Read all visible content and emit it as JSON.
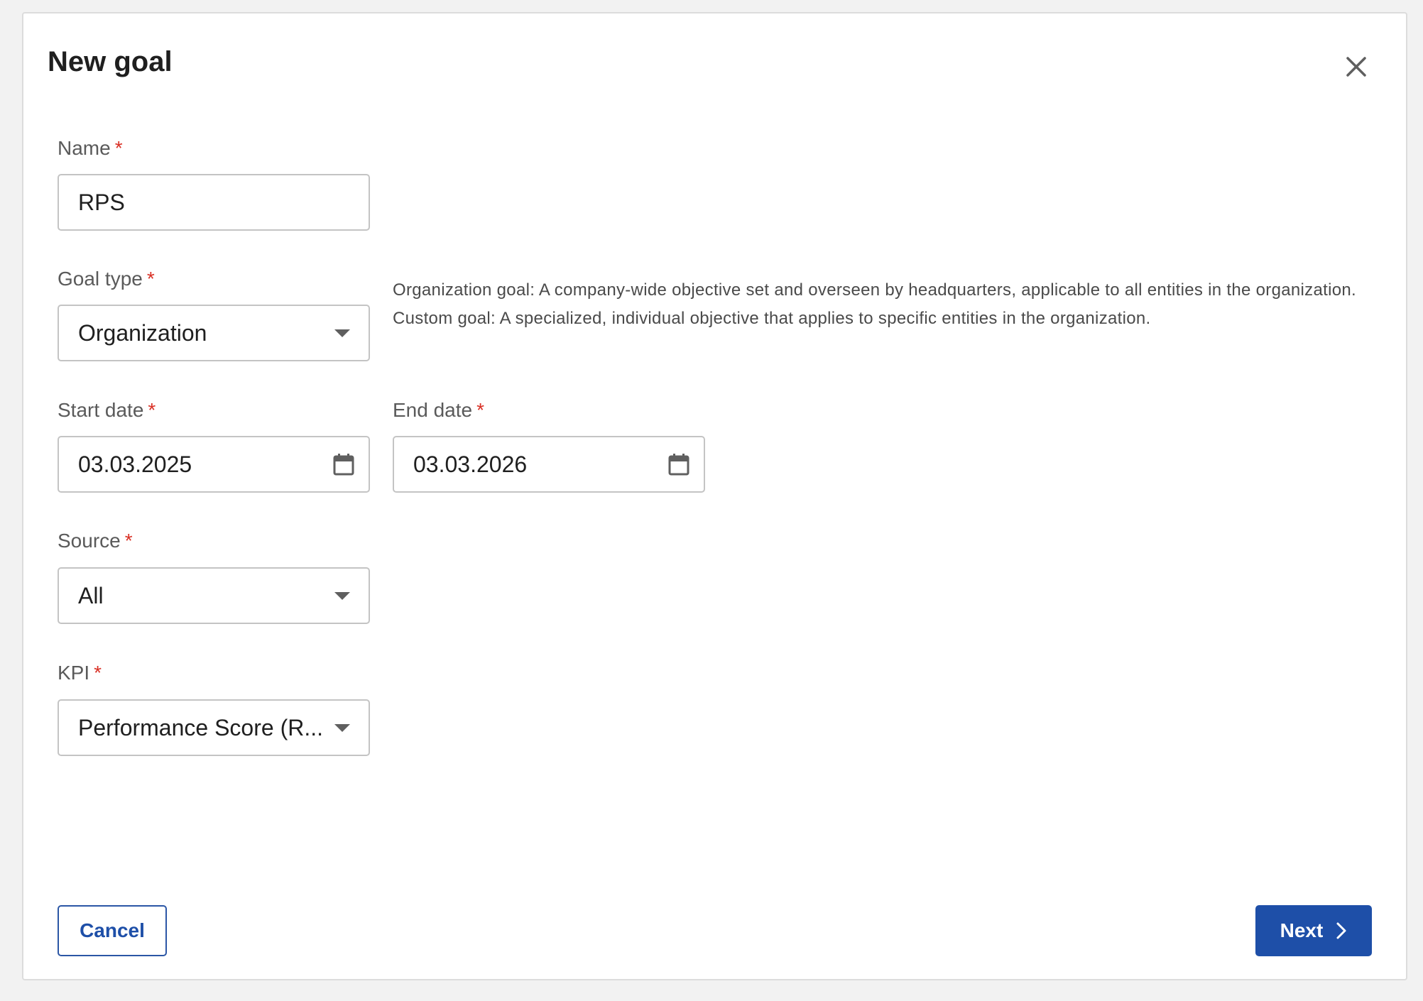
{
  "dialog": {
    "title": "New goal",
    "close_icon": "close-icon"
  },
  "form": {
    "name": {
      "label": "Name",
      "required_mark": "*",
      "value": "RPS"
    },
    "goal_type": {
      "label": "Goal type",
      "required_mark": "*",
      "value": "Organization"
    },
    "goal_type_help": [
      "Organization goal: A company-wide objective set and overseen by headquarters, applicable to all entities in the organization.",
      "Custom goal: A specialized, individual objective that applies to specific entities in the organization."
    ],
    "start_date": {
      "label": "Start date",
      "required_mark": "*",
      "value": "03.03.2025",
      "icon": "calendar-icon"
    },
    "end_date": {
      "label": "End date",
      "required_mark": "*",
      "value": "03.03.2026",
      "icon": "calendar-icon"
    },
    "source": {
      "label": "Source",
      "required_mark": "*",
      "value": "All"
    },
    "kpi": {
      "label": "KPI",
      "required_mark": "*",
      "value": "Performance Score (R..."
    }
  },
  "footer": {
    "cancel_label": "Cancel",
    "next_label": "Next",
    "next_icon": "chevron-right-icon"
  },
  "colors": {
    "primary": "#1e4fa8",
    "required": "#d93025",
    "border": "#c4c4c4"
  }
}
